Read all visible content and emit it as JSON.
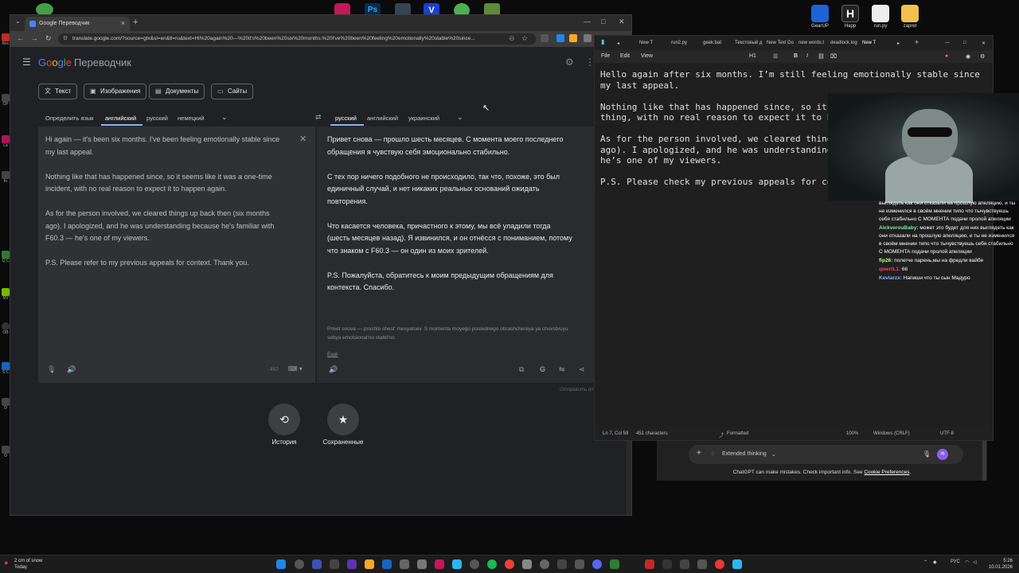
{
  "desktop_icons": [
    "GearUP",
    "Happ",
    "run.py",
    "zapret"
  ],
  "left_strip_labels": [
    "Rec",
    "CP",
    "La",
    "fo",
    "Q C",
    "NV",
    "OB",
    "S C",
    "D",
    "O"
  ],
  "chrome": {
    "tab_title": "Google Переводчик",
    "url": "translate.google.com/?source=gtx&sl=en&tl=ru&text=Hi%20again%20—%20it's%20been%20six%20months.%20I've%20been%20feeling%20emotionally%20stable%20since..."
  },
  "translate": {
    "product": "Переводчик",
    "modes": [
      "Текст",
      "Изображения",
      "Документы",
      "Сайты"
    ],
    "source_langs": [
      "Определить язык",
      "английский",
      "русский",
      "немецкий"
    ],
    "target_langs": [
      "русский",
      "английский",
      "украинский"
    ],
    "source_paragraphs": [
      "Hi again — it's been six months. I've been feeling emotionally stable since my last appeal.",
      "Nothing like that has happened since, so it seems like it was a one-time incident, with no real reason to expect it to happen again.",
      "As for the person involved, we cleared things up back then (six months ago). I apologized, and he was understanding because he's familiar with F60.3 — he's one of my viewers.",
      "P.S. Please refer to my previous appeals for context. Thank you."
    ],
    "char_count": "457",
    "target_paragraphs": [
      "Привет снова — прошло шесть месяцев. С момента моего последнего обращения я чувствую себя эмоционально стабильно.",
      "С тех пор ничего подобного не происходило, так что, похоже, это был единичный случай, и нет никаких реальных оснований ожидать повторения.",
      "Что касается человека, причастного к этому, мы всё уладили тогда (шесть месяцев назад). Я извинился, и он отнёсся с пониманием, потому что знаком с F60.3 — он один из моих зрителей.",
      "P.S. Пожалуйста, обратитесь к моим предыдущим обращениям для контекста. Спасибо."
    ],
    "transliteration": "Privet snova — proshlo shest' mesyatsev. S momenta moyego poslednego obrashcheniya ya chuvstvuyu sebya emotsional'no stabil'no.",
    "more_label": "Ещё",
    "feedback": "Отправить отзыв",
    "history_label": "История",
    "saved_label": "Сохраненные"
  },
  "notepad": {
    "tabs": [
      "New T",
      "run2.py",
      "geek.bat",
      "Текстовый д",
      "New Text Do",
      "new words.t",
      "deadlock.log",
      "New T"
    ],
    "menu": [
      "File",
      "Edit",
      "View"
    ],
    "heading_dropdown": "H1",
    "body": "Hello again after six months. I’m still feeling emotionally stable since my last appeal.\n\nNothing like that has happened since, so it\nthing, with no real reason to expect it to h\n\nAs for the person involved, we cleared thing\nago). I apologized, and he was understanding\nhe’s one of my viewers.\n\nP.S. Please check my previous appeals for co",
    "status": {
      "position": "Ln 7, Col 59",
      "chars": "451 characters",
      "format": "Formatted",
      "zoom": "100%",
      "eol": "Windows (CRLF)",
      "encoding": "UTF-8"
    }
  },
  "chat": [
    {
      "user": "",
      "text": "выглядеть как они отказали на прошлую апеляцию, и ты не изменился в своём мнении типо что тычувствуешь себя стабильно С МОМЕНТА подачи пролой апеляции",
      "color": "#ffffff"
    },
    {
      "user": "AickverouBaby:",
      "text": "может это будет для них выглядеть как они отказали на прошлую апеляцию, и ты не изменился в своём мнении типо что тычувствуешь себя стабильно С МОМЕНТА подачи пролой апеляции",
      "color": "#7ee8a6"
    },
    {
      "user": "flp26:",
      "text": "полегче парень,мы на фредли вайбе",
      "color": "#b5ff7a"
    },
    {
      "user": "qwertL1:",
      "text": "66",
      "color": "#ff3b5c"
    },
    {
      "user": "Kevlarzx:",
      "text": "Напиши что ты сын Мадуро",
      "color": "#8ab4f8"
    }
  ],
  "chatgpt": {
    "mode": "Extended thinking",
    "note": "ChatGPT can make mistakes. Check important info. See",
    "link": "Cookie Preferences",
    "note_end": "."
  },
  "taskbar": {
    "weather_line1": "2 cm of snow",
    "weather_line2": "Today",
    "lang": "РУС",
    "time": "5:26",
    "date": "10.01.2026"
  }
}
